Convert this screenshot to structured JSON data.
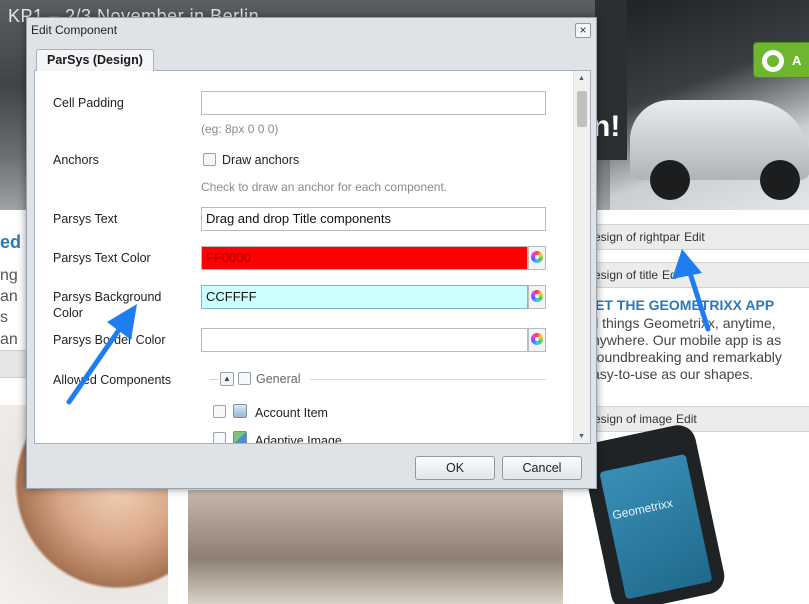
{
  "background": {
    "hero_title": "KP1 – 2/3 November in Berlin",
    "hero_fragment": "n!",
    "green_button_letter": "A",
    "left_heading_fragment": "ed",
    "left_text_lines": [
      "ng",
      "an",
      "s an"
    ],
    "design_bars": [
      {
        "label": "esign of rightpar",
        "edit": "Edit"
      },
      {
        "label": "esign of title",
        "edit": "Ed"
      },
      {
        "label": "esign of image",
        "edit": "Edit"
      }
    ],
    "geometrixx_heading": "ET THE GEOMETRIXX APP",
    "geometrixx_text": "ll things Geometrixx, anytime, nywhere. Our mobile app is as roundbreaking and remarkably asy-to-use as our shapes.",
    "phone_brand": "Geometrixx"
  },
  "dialog": {
    "title": "Edit Component",
    "close_glyph": "×",
    "tab_label": "ParSys (Design)",
    "fields": {
      "cell_padding": {
        "label": "Cell Padding",
        "value": "",
        "hint": "(eg: 8px 0 0 0)"
      },
      "anchors": {
        "label": "Anchors",
        "checkbox_label": "Draw anchors",
        "hint": "Check to draw an anchor for each component."
      },
      "parsys_text": {
        "label": "Parsys Text",
        "value": "Drag and drop Title components"
      },
      "parsys_text_color": {
        "label": "Parsys Text Color",
        "value": "FF0000",
        "swatch": "#ff0000"
      },
      "parsys_background_color": {
        "label_line1": "Parsys Background",
        "label_line2": "Color",
        "value": "CCFFFF",
        "swatch": "#ccffff"
      },
      "parsys_border_color": {
        "label": "Parsys Border Color",
        "value": ""
      },
      "allowed_components": {
        "label": "Allowed Components",
        "group": "General",
        "items": [
          "Account Item",
          "Adaptive Image"
        ]
      }
    },
    "buttons": {
      "ok": "OK",
      "cancel": "Cancel"
    }
  },
  "colors": {
    "annotation_arrow": "#1e7ef0",
    "highlight_text": "#ff0000"
  }
}
